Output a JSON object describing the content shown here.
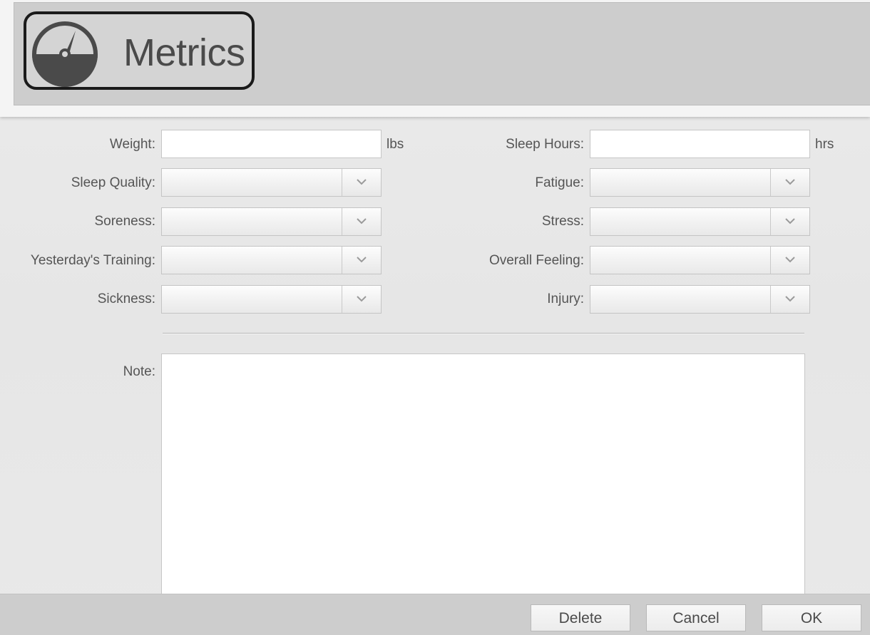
{
  "header": {
    "title": "Metrics",
    "icon": "gauge-icon"
  },
  "form": {
    "weight": {
      "label": "Weight:",
      "value": "",
      "unit": "lbs"
    },
    "sleep_hours": {
      "label": "Sleep Hours:",
      "value": "",
      "unit": "hrs"
    },
    "sleep_quality": {
      "label": "Sleep Quality:",
      "value": ""
    },
    "fatigue": {
      "label": "Fatigue:",
      "value": ""
    },
    "soreness": {
      "label": "Soreness:",
      "value": ""
    },
    "stress": {
      "label": "Stress:",
      "value": ""
    },
    "yesterdays_training": {
      "label": "Yesterday's Training:",
      "value": ""
    },
    "overall_feeling": {
      "label": "Overall Feeling:",
      "value": ""
    },
    "sickness": {
      "label": "Sickness:",
      "value": ""
    },
    "injury": {
      "label": "Injury:",
      "value": ""
    },
    "note": {
      "label": "Note:",
      "value": ""
    }
  },
  "footer": {
    "delete_label": "Delete",
    "cancel_label": "Cancel",
    "ok_label": "OK"
  },
  "colors": {
    "header_bg": "#cdcdcd",
    "body_bg": "#e8e8e8",
    "label_text": "#555555",
    "title_text": "#4a4a4a"
  }
}
